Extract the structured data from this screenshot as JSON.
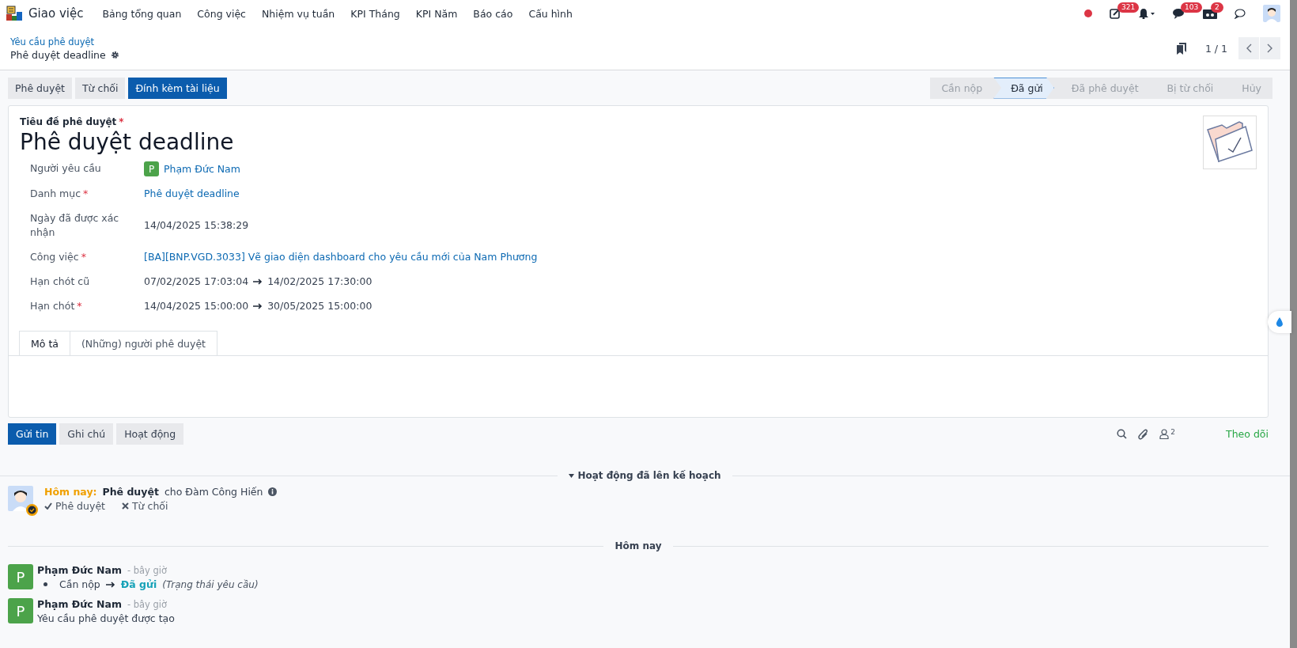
{
  "navbar": {
    "app_name": "Giao việc",
    "menu": [
      "Bảng tổng quan",
      "Công việc",
      "Nhiệm vụ tuần",
      "KPI Tháng",
      "KPI Năm",
      "Báo cáo",
      "Cấu hình"
    ],
    "systray": [
      {
        "kind": "dot"
      },
      {
        "kind": "activity",
        "badge": "321"
      },
      {
        "kind": "bell"
      },
      {
        "kind": "chat",
        "badge": "103"
      },
      {
        "kind": "box",
        "badge": "2"
      },
      {
        "kind": "bubble"
      },
      {
        "kind": "avatar"
      }
    ]
  },
  "breadcrumb": {
    "parent": "Yêu cầu phê duyệt",
    "current": "Phê duyệt deadline"
  },
  "pager": {
    "value": "1 / 1"
  },
  "actions": [
    {
      "label": "Phê duyệt",
      "primary": false
    },
    {
      "label": "Từ chối",
      "primary": false
    },
    {
      "label": "Đính kèm tài liệu",
      "primary": true
    }
  ],
  "statusbar": [
    {
      "label": "Cần nộp",
      "selected": false
    },
    {
      "label": "Đã gửi",
      "selected": true
    },
    {
      "label": "Đã phê duyệt",
      "selected": false
    },
    {
      "label": "Bị từ chối",
      "selected": false
    },
    {
      "label": "Hủy",
      "selected": false
    }
  ],
  "form": {
    "title_label": "Tiêu đề phê duyệt",
    "title_required": true,
    "required_mark": "*",
    "title": "Phê duyệt deadline",
    "fields": [
      {
        "label": "Người yêu cầu",
        "required": false,
        "kind": "person",
        "initial": "P",
        "value": "Phạm Đức Nam"
      },
      {
        "label": "Danh mục",
        "required": true,
        "kind": "link",
        "value": "Phê duyệt deadline"
      },
      {
        "label": "Ngày đã được xác nhận",
        "required": false,
        "kind": "text",
        "value": "14/04/2025 15:38:29"
      },
      {
        "label": "Công việc",
        "required": true,
        "kind": "link",
        "value": "[BA][BNP.VGD.3033] Vẽ giao diện dashboard cho yêu cầu mới của Nam Phương"
      },
      {
        "label": "Hạn chót cũ",
        "required": false,
        "kind": "range",
        "from": "07/02/2025 17:03:04",
        "to": "14/02/2025 17:30:00"
      },
      {
        "label": "Hạn chót",
        "required": true,
        "kind": "range",
        "from": "14/04/2025 15:00:00",
        "to": "30/05/2025 15:00:00"
      }
    ],
    "tabs": [
      {
        "label": "Mô tả",
        "selected": true
      },
      {
        "label": "(Những) người phê duyệt",
        "selected": false
      }
    ]
  },
  "chatter": {
    "buttons": [
      {
        "label": "Gửi tin",
        "selected": true
      },
      {
        "label": "Ghi chú",
        "selected": false
      },
      {
        "label": "Hoạt động",
        "selected": false
      }
    ],
    "follower_count": "2",
    "follow": "Theo dõi",
    "planned_header": "Hoạt động đã lên kế hoạch",
    "activity": {
      "when": "Hôm nay:",
      "type": "Phê duyệt",
      "assignee": "cho Đàm Công Hiến",
      "actions": [
        "Phê duyệt",
        "Từ chối"
      ]
    },
    "date_separator": "Hôm nay",
    "messages": [
      {
        "initial": "P",
        "author": "Phạm Đức Nam",
        "time": "- bây giờ",
        "kind": "tracking",
        "old": "Cần nộp",
        "new": "Đã gửi",
        "field": "(Trạng thái yêu cầu)"
      },
      {
        "initial": "P",
        "author": "Phạm Đức Nam",
        "time": "- bây giờ",
        "kind": "body",
        "body": "Yêu cầu phê duyệt được tạo"
      }
    ]
  }
}
